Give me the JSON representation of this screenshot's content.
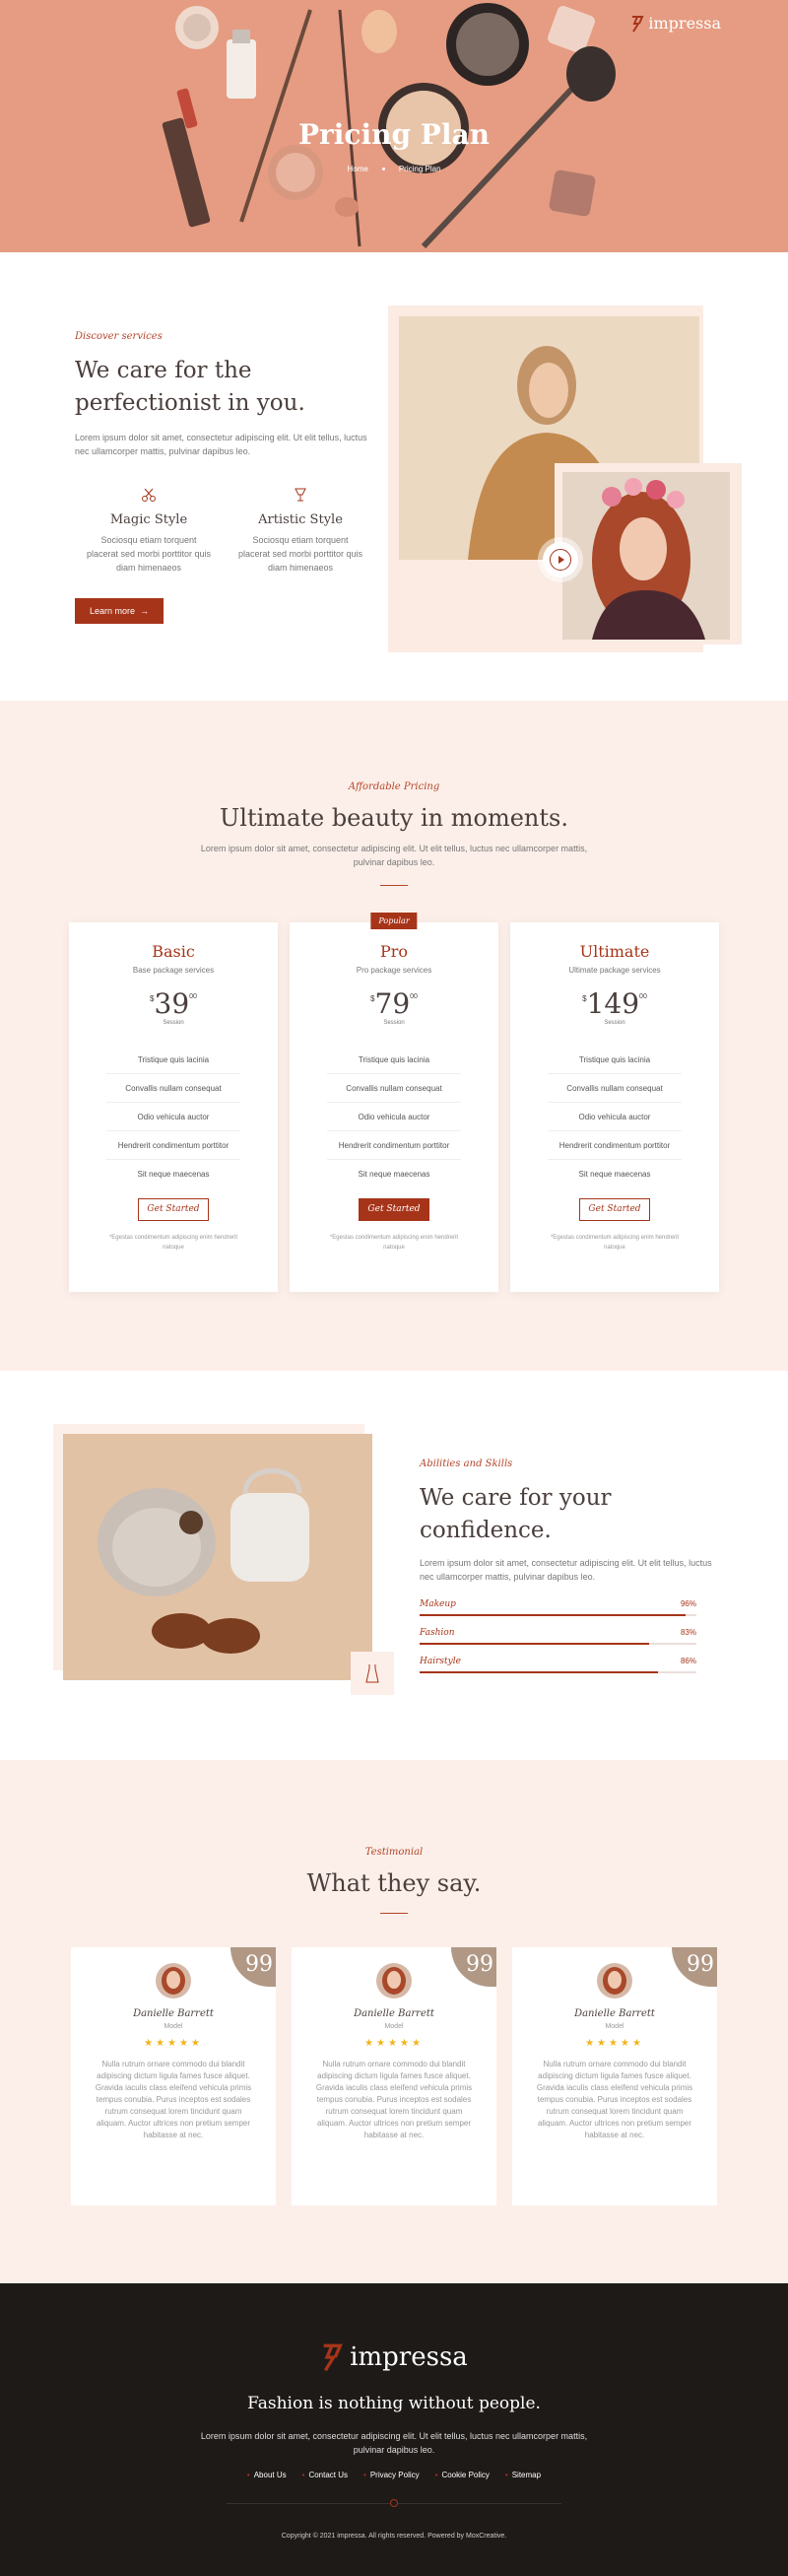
{
  "brand": {
    "name": "impressa",
    "accent": "#a63419",
    "hero_bg": "#e49a80",
    "soft_bg": "#fcefe9",
    "footer_bg": "#1e1a18"
  },
  "hero": {
    "title": "Pricing Plan",
    "breadcrumb": [
      "Home",
      "Pricing Plan"
    ]
  },
  "services": {
    "tag": "Discover services",
    "title": "We care for the perfectionist in you.",
    "intro": "Lorem ipsum dolor sit amet, consectetur adipiscing elit. Ut elit tellus, luctus nec ullamcorper mattis, pulvinar dapibus leo.",
    "features": [
      {
        "icon": "scissors-icon",
        "title": "Magic Style",
        "text": "Sociosqu etiam torquent placerat sed morbi porttitor quis diam himenaeos"
      },
      {
        "icon": "goblet-icon",
        "title": "Artistic Style",
        "text": "Sociosqu etiam torquent placerat sed morbi porttitor quis diam himenaeos"
      }
    ],
    "button": "Learn more"
  },
  "pricing": {
    "tag": "Affordable Pricing",
    "title": "Ultimate beauty in moments.",
    "intro": "Lorem ipsum dolor sit amet, consectetur adipiscing elit. Ut elit tellus, luctus nec ullamcorper mattis, pulvinar dapibus leo.",
    "plans": [
      {
        "name": "Basic",
        "sub": "Base package services",
        "currency": "$",
        "amount": "39",
        "cents": "00",
        "per": "Session",
        "features": [
          "Tristique quis lacinia",
          "Convallis nullam consequat",
          "Odio vehicula auctor",
          "Hendrerit condimentum porttitor",
          "Sit neque maecenas"
        ],
        "button": "Get Started",
        "note": "*Egestas condimentum adipiscing enim hendrerit natoque"
      },
      {
        "name": "Pro",
        "badge": "Popular",
        "sub": "Pro package services",
        "currency": "$",
        "amount": "79",
        "cents": "00",
        "per": "Session",
        "features": [
          "Tristique quis lacinia",
          "Convallis nullam consequat",
          "Odio vehicula auctor",
          "Hendrerit condimentum porttitor",
          "Sit neque maecenas"
        ],
        "button": "Get Started",
        "note": "*Egestas condimentum adipiscing enim hendrerit natoque"
      },
      {
        "name": "Ultimate",
        "sub": "Ultimate package services",
        "currency": "$",
        "amount": "149",
        "cents": "00",
        "per": "Session",
        "features": [
          "Tristique quis lacinia",
          "Convallis nullam consequat",
          "Odio vehicula auctor",
          "Hendrerit condimentum porttitor",
          "Sit neque maecenas"
        ],
        "button": "Get Started",
        "note": "*Egestas condimentum adipiscing enim hendrerit natoque"
      }
    ]
  },
  "skills": {
    "tag": "Abilities and Skills",
    "title": "We care for your confidence.",
    "intro": "Lorem ipsum dolor sit amet, consectetur adipiscing elit. Ut elit tellus, luctus nec ullamcorper mattis, pulvinar dapibus leo.",
    "bars": [
      {
        "label": "Makeup",
        "pct_text": "96%",
        "value": 0.96
      },
      {
        "label": "Fashion",
        "pct_text": "83%",
        "value": 0.83
      },
      {
        "label": "Hairstyle",
        "pct_text": "86%",
        "value": 0.86
      }
    ]
  },
  "testimonials": {
    "tag": "Testimonial",
    "title": "What they say.",
    "items": [
      {
        "name": "Danielle Barrett",
        "role": "Model",
        "rating": 5,
        "text": "Nulla rutrum ornare commodo dui blandit adipiscing dictum ligula fames fusce aliquet. Gravida iaculis class eleifend vehicula primis tempus conubia. Purus inceptos est sodales rutrum consequat lorem tincidunt quam aliquam. Auctor ultrices non pretium semper habitasse at nec."
      },
      {
        "name": "Danielle Barrett",
        "role": "Model",
        "rating": 5,
        "text": "Nulla rutrum ornare commodo dui blandit adipiscing dictum ligula fames fusce aliquet. Gravida iaculis class eleifend vehicula primis tempus conubia. Purus inceptos est sodales rutrum consequat lorem tincidunt quam aliquam. Auctor ultrices non pretium semper habitasse at nec."
      },
      {
        "name": "Danielle Barrett",
        "role": "Model",
        "rating": 5,
        "text": "Nulla rutrum ornare commodo dui blandit adipiscing dictum ligula fames fusce aliquet. Gravida iaculis class eleifend vehicula primis tempus conubia. Purus inceptos est sodales rutrum consequat lorem tincidunt quam aliquam. Auctor ultrices non pretium semper habitasse at nec."
      }
    ]
  },
  "footer": {
    "tagline": "Fashion is nothing without people.",
    "text": "Lorem ipsum dolor sit amet, consectetur adipiscing elit. Ut elit tellus, luctus nec ullamcorper mattis, pulvinar dapibus leo.",
    "links": [
      "About Us",
      "Contact Us",
      "Privacy Policy",
      "Cookie Policy",
      "Sitemap"
    ],
    "copyright": "Copyright © 2021 impressa. All rights reserved. Powered by MoxCreative."
  }
}
